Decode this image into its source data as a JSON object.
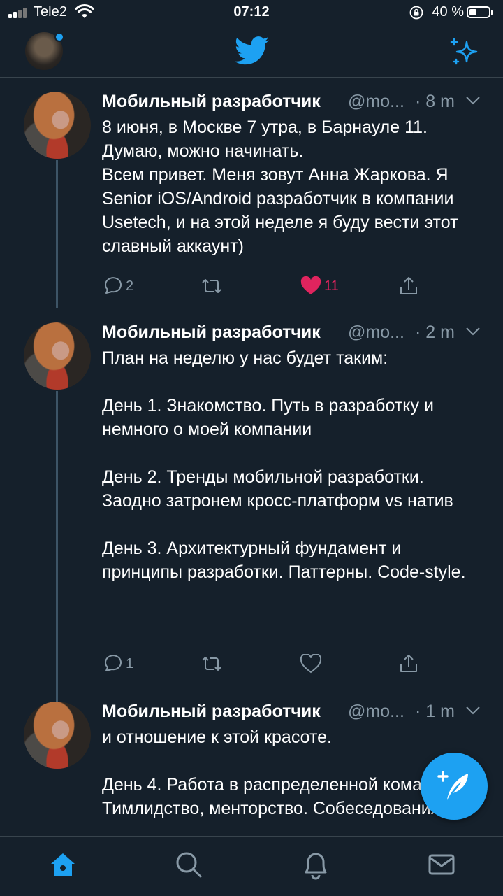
{
  "status_bar": {
    "carrier": "Tele2",
    "time": "07:12",
    "battery": "40 %",
    "battery_level": 0.4
  },
  "header": {
    "logo_icon": "twitter-bird-icon",
    "sparkle_icon": "sparkle-icon",
    "colors": {
      "accent": "#1da1f2",
      "background": "#15202b",
      "divider": "#38444d"
    }
  },
  "tweets": [
    {
      "name": "Мобильный разработчик",
      "handle": "@mo...",
      "time": "· 8 m",
      "text": "8 июня, в Москве 7 утра, в Барнауле 11. Думаю, можно начинать.\nВсем привет. Меня зовут Анна Жаркова. Я Senior iOS/Android разработчик в компании Usetech, и на этой неделе я буду вести этот славный аккаунт)",
      "replies": "2",
      "retweets": "",
      "likes": "11",
      "liked": true
    },
    {
      "name": "Мобильный разработчик",
      "handle": "@mo...",
      "time": "· 2 m",
      "text": "План на неделю у нас будет таким:\n\nДень 1. Знакомство. Путь в разработку и немного о моей компании\n\nДень 2. Тренды мобильной разработки. Заодно затронем кросс-платформ vs натив\n\nДень 3. Архитектурный фундамент и принципы разработки. Паттерны. Code-style.",
      "replies": "1",
      "retweets": "",
      "likes": "",
      "liked": false
    },
    {
      "name": "Мобильный разработчик",
      "handle": "@mo...",
      "time": "· 1 m",
      "text": "и отношение к этой красоте.\n\nДень 4. Работа в распределенной команде. Тимлидство, менторство. Собеседования",
      "replies": "",
      "retweets": "",
      "likes": "",
      "liked": false
    }
  ],
  "tab_bar": [
    "home-icon",
    "search-icon",
    "notifications-icon",
    "messages-icon"
  ]
}
